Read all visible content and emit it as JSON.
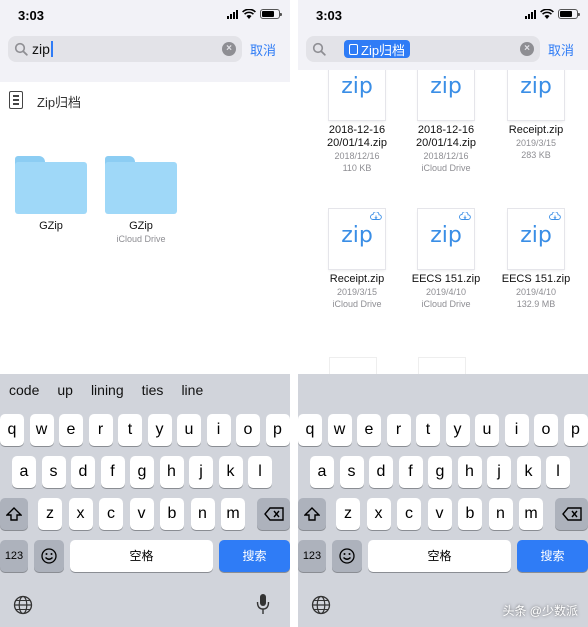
{
  "left": {
    "time": "3:03",
    "search": {
      "value": "zip",
      "cancel_label": "取消"
    },
    "suggestion": {
      "label": "Zip归档"
    },
    "folders": [
      {
        "name": "GZip",
        "location": ""
      },
      {
        "name": "GZip",
        "location": "iCloud Drive"
      }
    ],
    "predictions": [
      "code",
      "up",
      "lining",
      "ties",
      "line"
    ]
  },
  "right": {
    "time": "3:03",
    "search": {
      "token_label": "Zip归档",
      "cancel_label": "取消"
    },
    "files": [
      {
        "thumb": "zip",
        "name": "2018-12-16 20/01/14.zip",
        "date": "2018/12/16",
        "detail": "110 KB",
        "cloud": false
      },
      {
        "thumb": "zip",
        "name": "2018-12-16 20/01/14.zip",
        "date": "2018/12/16",
        "detail": "iCloud Drive",
        "cloud": false
      },
      {
        "thumb": "zip",
        "name": "Receipt.zip",
        "date": "2019/3/15",
        "detail": "283 KB",
        "cloud": false
      },
      {
        "thumb": "zip",
        "name": "Receipt.zip",
        "date": "2019/3/15",
        "detail": "iCloud Drive",
        "cloud": true
      },
      {
        "thumb": "zip",
        "name": "EECS 151.zip",
        "date": "2019/4/10",
        "detail": "iCloud Drive",
        "cloud": true
      },
      {
        "thumb": "zip",
        "name": "EECS 151.zip",
        "date": "2019/4/10",
        "detail": "132.9 MB",
        "cloud": true
      }
    ]
  },
  "keyboard": {
    "row1": [
      "q",
      "w",
      "e",
      "r",
      "t",
      "y",
      "u",
      "i",
      "o",
      "p"
    ],
    "row2": [
      "a",
      "s",
      "d",
      "f",
      "g",
      "h",
      "j",
      "k",
      "l"
    ],
    "row3": [
      "z",
      "x",
      "c",
      "v",
      "b",
      "n",
      "m"
    ],
    "numbers_label": "123",
    "space_label": "空格",
    "search_label": "搜索",
    "shift_icon": "shift-arrow-icon",
    "delete_icon": "delete-backspace-icon",
    "emoji_icon": "emoji-smile-icon",
    "globe_icon": "globe-icon",
    "mic_icon": "microphone-icon"
  },
  "watermark": "头条 @少数派",
  "colors": {
    "accent": "#2f7cf6",
    "folder": "#9fd8f8",
    "keyboard_bg": "#d1d4db",
    "zip_text": "#3a8ee6"
  }
}
